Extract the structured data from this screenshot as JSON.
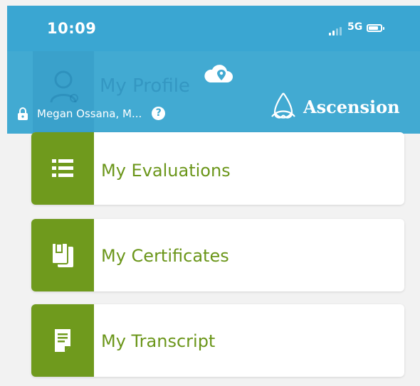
{
  "status_bar": {
    "time": "10:09",
    "network": "5G"
  },
  "header": {
    "background_menu_item": "My Profile",
    "user_name": "Megan Ossana, M...",
    "help_symbol": "?",
    "brand_name": "Ascension"
  },
  "menu": {
    "items": [
      {
        "label": "My Evaluations",
        "icon": "list-icon"
      },
      {
        "label": "My Certificates",
        "icon": "certificate-icon"
      },
      {
        "label": "My Transcript",
        "icon": "document-icon"
      }
    ]
  },
  "colors": {
    "header_blue": "#42aad2",
    "accent_green": "#6f9a1d",
    "label_green": "#6b961a",
    "background": "#f2f2f2"
  }
}
